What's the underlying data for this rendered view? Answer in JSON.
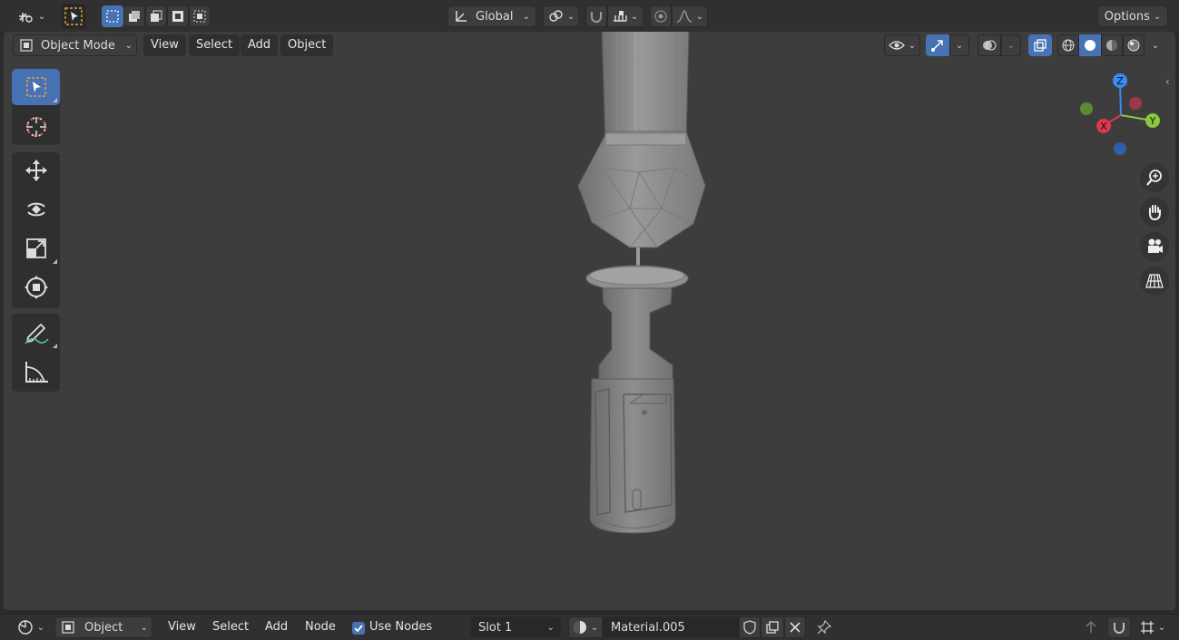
{
  "header": {
    "transform_orientation": "Global",
    "options_label": "Options"
  },
  "viewport_header": {
    "mode_label": "Object Mode",
    "menus": [
      "View",
      "Select",
      "Add",
      "Object"
    ]
  },
  "toolbar": {
    "tools": [
      "select-box",
      "cursor",
      "move",
      "rotate",
      "scale",
      "transform",
      "annotate",
      "measure"
    ],
    "active_tool": "select-box"
  },
  "gizmo": {
    "axes": [
      "X",
      "Y",
      "Z"
    ],
    "colors": {
      "x": "#e0384d",
      "y": "#8cc83e",
      "z": "#3a8af0"
    }
  },
  "navigation": [
    "zoom-icon",
    "hand-icon",
    "camera-icon",
    "grid-icon"
  ],
  "bottom_bar": {
    "editor_label": "Object",
    "menus": [
      "View",
      "Select",
      "Add",
      "Node"
    ],
    "use_nodes_label": "Use Nodes",
    "use_nodes_checked": true,
    "slot_label": "Slot 1",
    "material_name": "Material.005"
  },
  "colors": {
    "accent": "#4772b3",
    "viewport_bg": "#3d3d3d",
    "header_bg": "#303030"
  }
}
